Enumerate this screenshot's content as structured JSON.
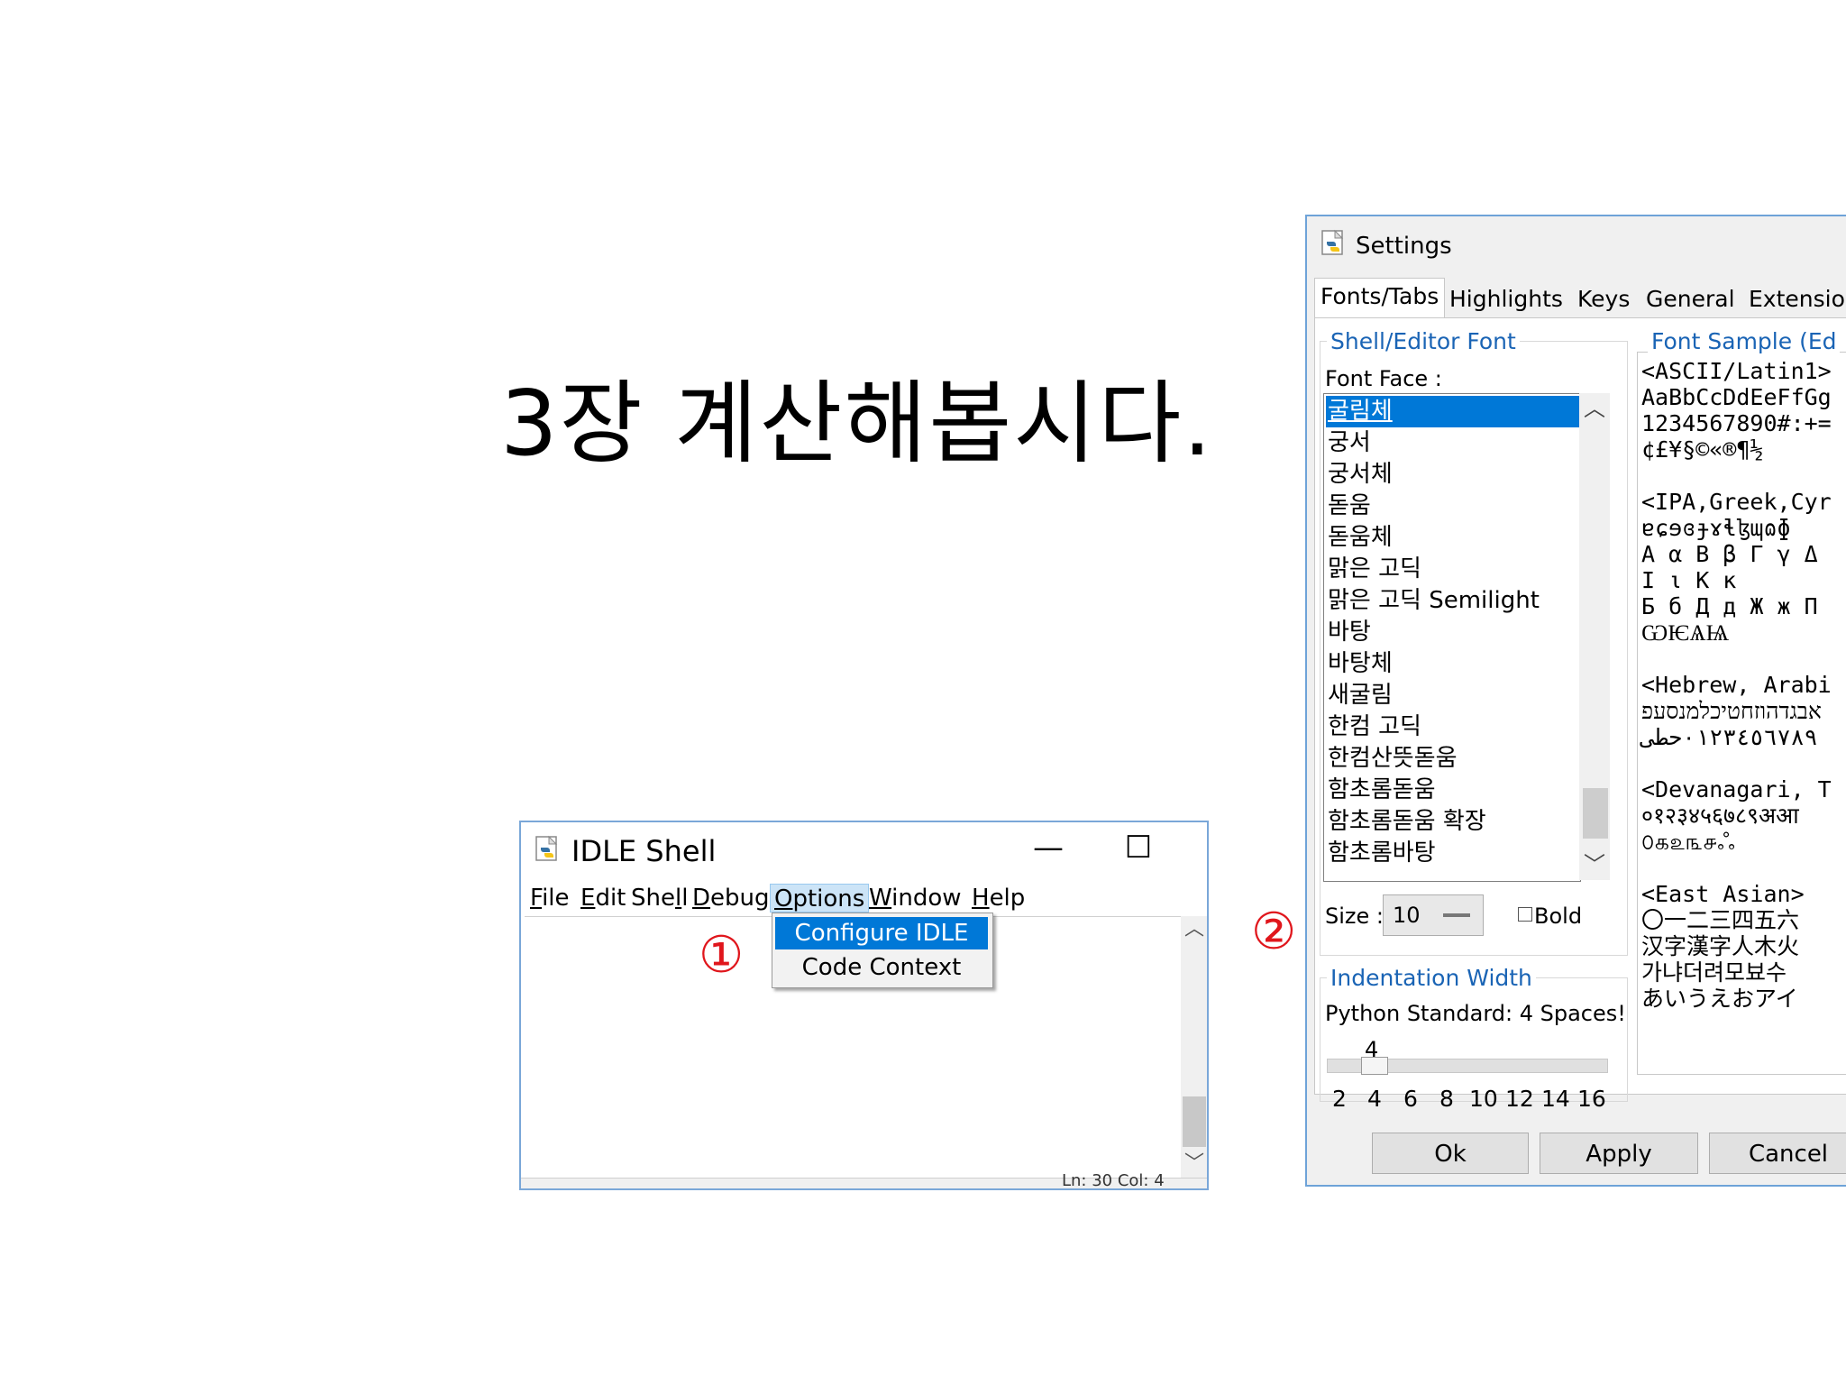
{
  "slide": {
    "title": "3장 계산해봅시다."
  },
  "idle_window": {
    "title": "IDLE Shell",
    "window_controls": {
      "minimize": "—",
      "maximize": "☐",
      "close": "✕"
    },
    "menu": [
      {
        "label": "File",
        "mnemonic": "F",
        "rest": "ile"
      },
      {
        "label": "Edit",
        "mnemonic": "E",
        "rest": "dit"
      },
      {
        "label": "Shell",
        "pre": "She",
        "mnemonic": "l",
        "rest": "l"
      },
      {
        "label": "Debug",
        "mnemonic": "D",
        "rest": "ebug"
      },
      {
        "label": "Options",
        "mnemonic": "O",
        "rest": "ptions"
      },
      {
        "label": "Window",
        "mnemonic": "W",
        "rest": "indow"
      },
      {
        "label": "Help",
        "mnemonic": "H",
        "rest": "elp"
      }
    ],
    "options_menu": [
      {
        "label": "Configure IDLE",
        "selected": true
      },
      {
        "label": "Code Context",
        "selected": false
      }
    ],
    "status_text": "Ln: 30 Col: 4"
  },
  "markers": {
    "step1": "①",
    "step2": "②",
    "color": "#e0161c"
  },
  "settings_window": {
    "title": "Settings",
    "tabs": [
      "Fonts/Tabs",
      "Highlights",
      "Keys",
      "General",
      "Extensior"
    ],
    "active_tab": "Fonts/Tabs",
    "shell_editor_font_label": "Shell/Editor Font",
    "font_face_label": "Font Face :",
    "fonts": [
      "굴림체",
      "궁서",
      "궁서체",
      "돋움",
      "돋움체",
      "맑은 고딕",
      "맑은 고딕 Semilight",
      "바탕",
      "바탕체",
      "새굴림",
      "한컴 고딕",
      "한컴산뜻돋움",
      "함초롬돋움",
      "함초롬돋움 확장",
      "함초롬바탕"
    ],
    "selected_font": "굴림체",
    "size_label": "Size :",
    "size_value": "10",
    "bold_label": "Bold",
    "indentation_label": "Indentation Width",
    "python_standard_label": "Python Standard: 4 Spaces!",
    "indent_value": "4",
    "indent_ticks": [
      "2",
      "4",
      "6",
      "8",
      "10",
      "12",
      "14",
      "16"
    ],
    "font_sample_label": "Font Sample (Ed",
    "font_sample_lines": [
      "<ASCII/Latin1>",
      "AaBbCcDdEeFfGg",
      "1234567890#:+=",
      "¢£¥§©«®¶½",
      "",
      "<IPA,Greek,Cyr",
      "ɐɕɘɞɟɤɬɮɰɷɸ",
      "Α α Β β Γ γ Δ",
      "Ι ι Κ κ",
      "Б б Д д Ж ж П",
      "ѠѤѦѨ",
      "",
      "<Hebrew, Arabi",
      "אבגדהוזחטיכלמנסעפ",
      "٠١٢٣٤٥٦٧٨٩حطى",
      "",
      "<Devanagari, T",
      "०१२३४५६७८९अआ",
      "௦௧௨௩௪ஃ",
      "",
      "<East Asian>",
      "〇一二三四五六",
      "汉字漢字人木火",
      "가냐더려모뵤수",
      "あいうえおアイ"
    ],
    "buttons": {
      "ok": "Ok",
      "apply": "Apply",
      "cancel": "Cancel"
    }
  }
}
